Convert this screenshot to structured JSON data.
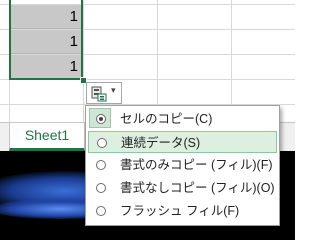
{
  "cells": [
    "1",
    "1",
    "1"
  ],
  "sheet_tab": "Sheet1",
  "quick_analysis": {
    "icon": "paste-options-icon",
    "arrow": "▾"
  },
  "menu": {
    "items": [
      {
        "label": "セルのコピー(C)",
        "selected": true
      },
      {
        "label": "連続データ(S)",
        "selected": false,
        "hover": true
      },
      {
        "label": "書式のみコピー (フィル)(F)",
        "selected": false
      },
      {
        "label": "書式なしコピー (フィル)(O)",
        "selected": false
      },
      {
        "label": "フラッシュ フィル(F)",
        "selected": false
      }
    ]
  },
  "colors": {
    "accent": "#217346",
    "selected_cell": "#c8c8c8",
    "hover": "#ddefe1"
  }
}
